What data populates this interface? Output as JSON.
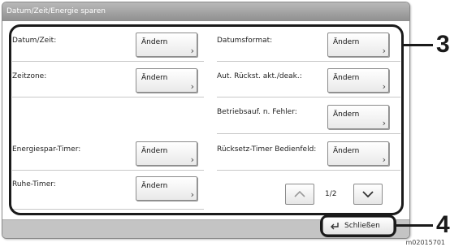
{
  "window": {
    "title": "Datum/Zeit/Energie sparen"
  },
  "settings": [
    {
      "label": "Datum/Zeit:",
      "button": "Ändern"
    },
    {
      "label": "Datumsformat:",
      "button": "Ändern"
    },
    {
      "label": "Zeitzone:",
      "button": "Ändern"
    },
    {
      "label": "Aut. Rückst. akt./deak.:",
      "button": "Ändern"
    },
    {
      "label": "Betriebsauf. n. Fehler:",
      "button": "Ändern"
    },
    {
      "label": "Energiespar-Timer:",
      "button": "Ändern"
    },
    {
      "label": "Rücksetz-Timer Bedienfeld:",
      "button": "Ändern"
    },
    {
      "label": "Ruhe-Timer:",
      "button": "Ändern"
    }
  ],
  "pager": {
    "text": "1/2",
    "up_icon": "chevron-up-icon",
    "down_icon": "chevron-down-icon"
  },
  "footer": {
    "close_label": "Schließen",
    "close_icon": "enter-return-icon"
  },
  "callouts": {
    "main": "3",
    "close": "4"
  },
  "figure_code": "m02015701"
}
